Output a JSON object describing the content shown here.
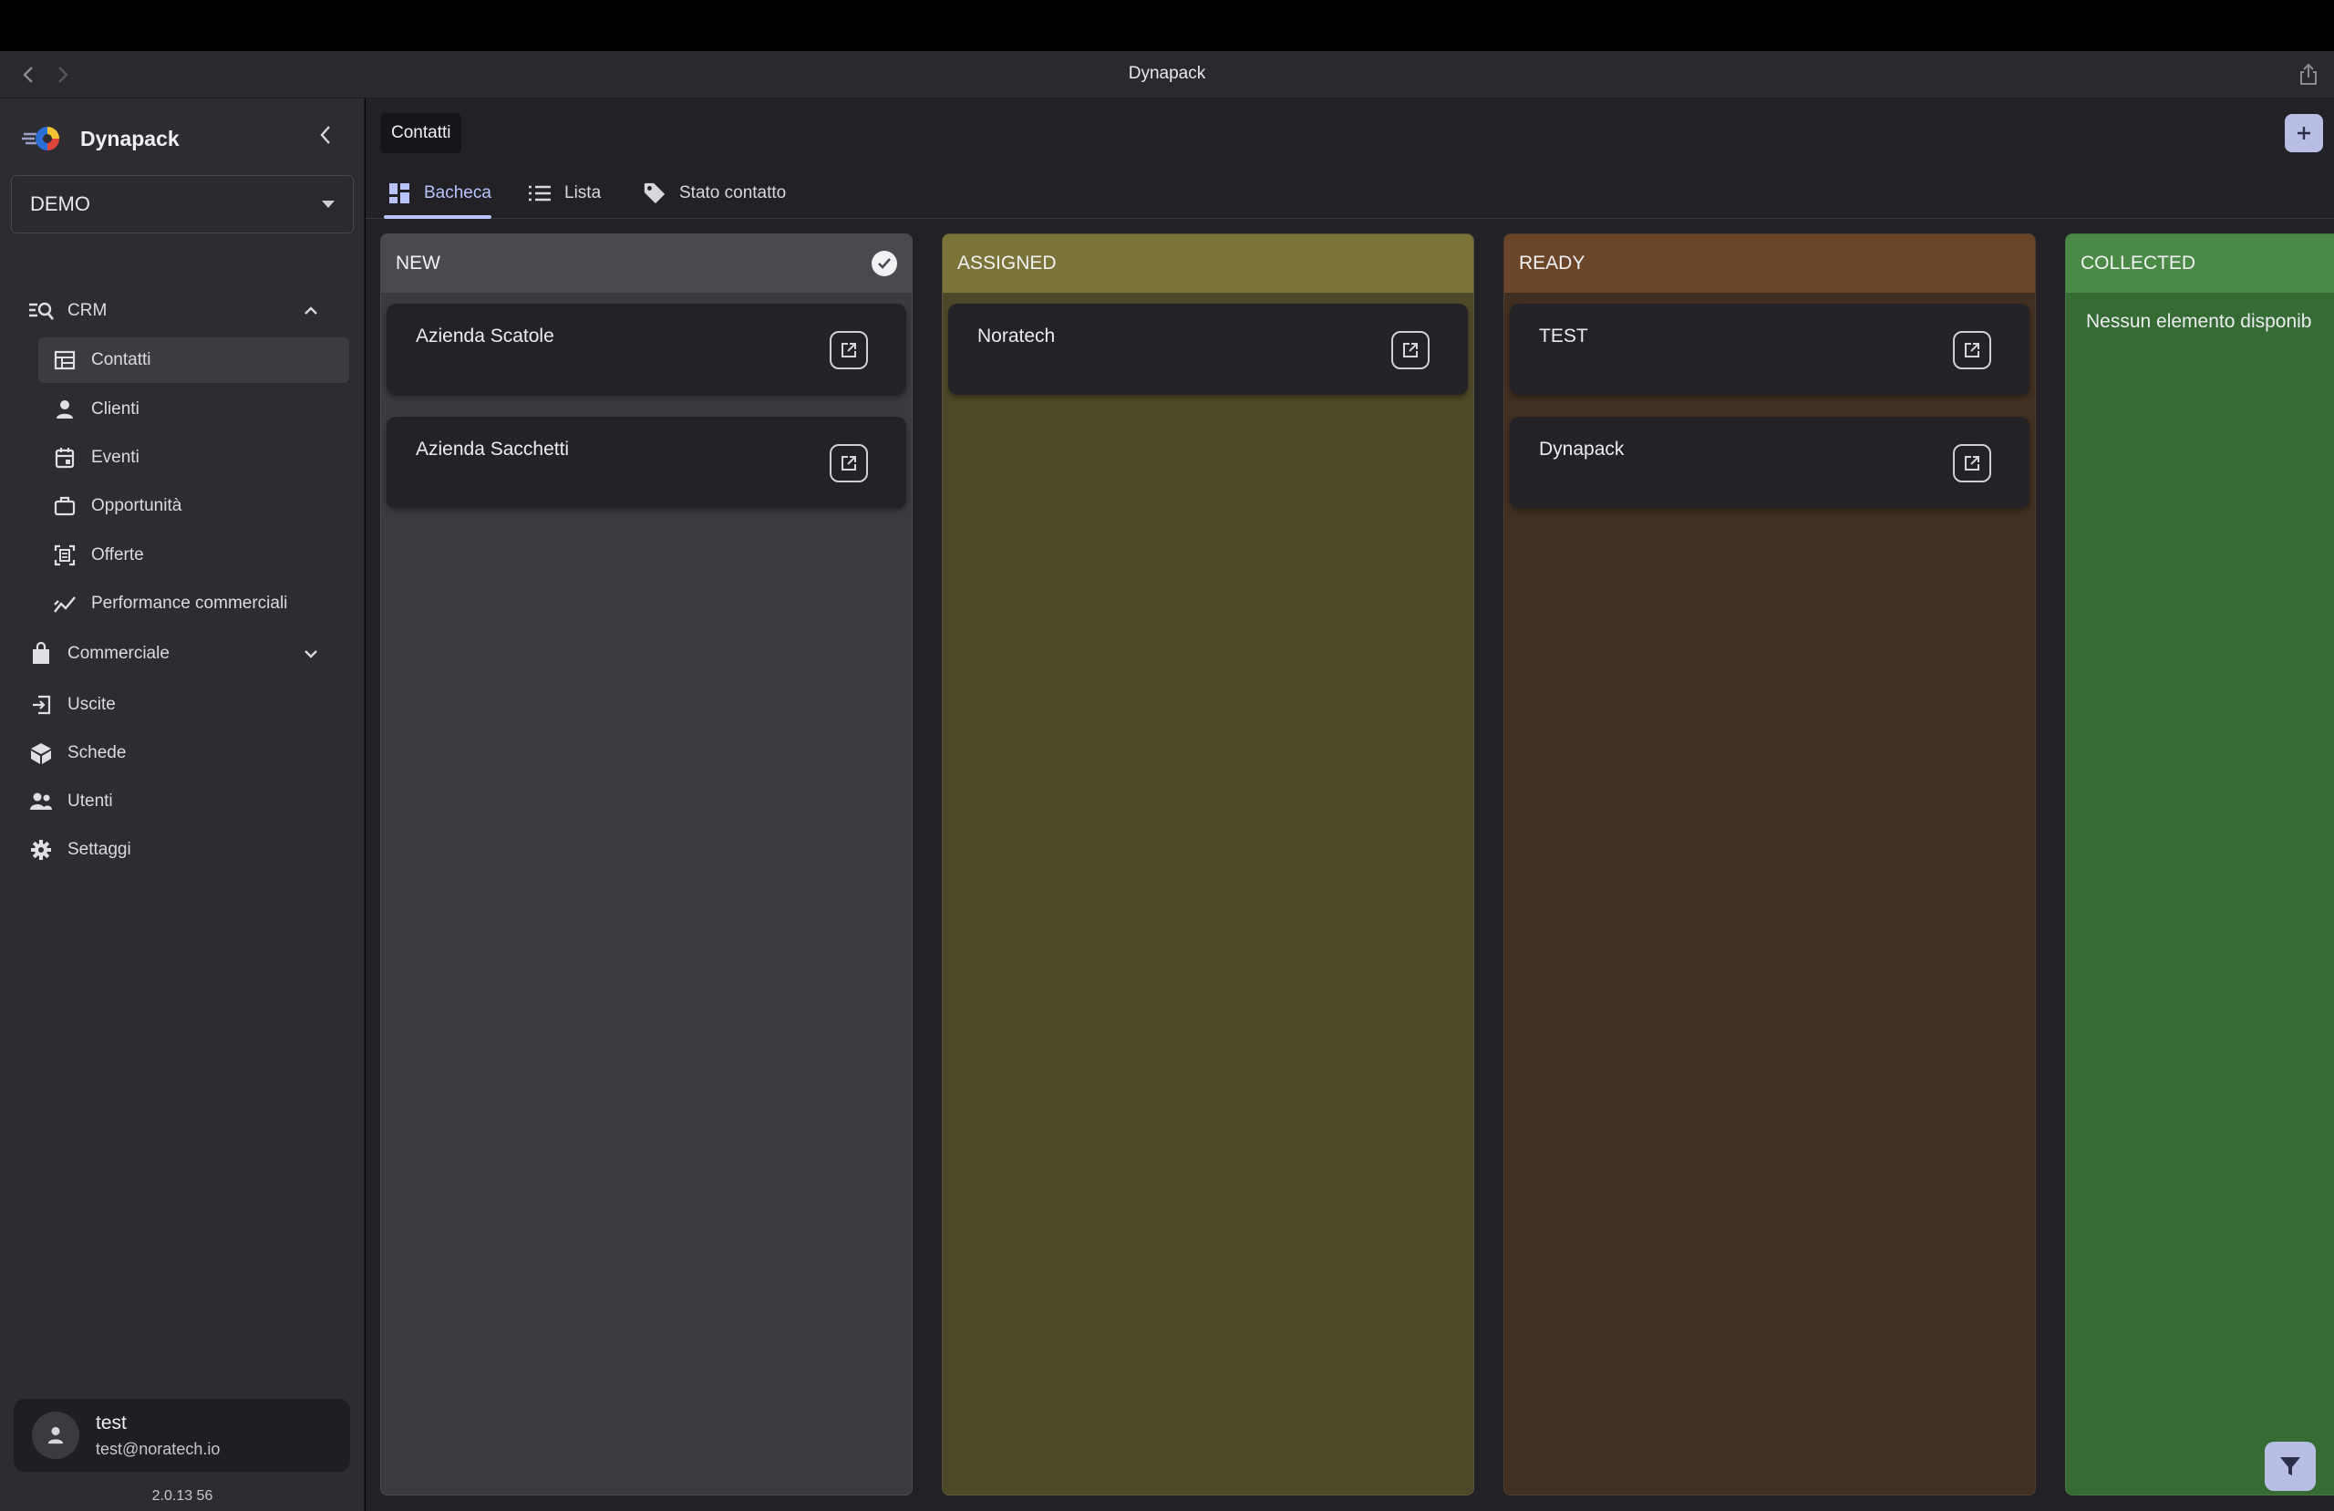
{
  "window": {
    "title": "Dynapack"
  },
  "sidebar": {
    "brand": "Dynapack",
    "environment": "DEMO",
    "menu": [
      {
        "label": "CRM",
        "icon": "crm-search-icon"
      },
      {
        "label": "Contatti",
        "icon": "table-icon"
      },
      {
        "label": "Clienti",
        "icon": "person-icon"
      },
      {
        "label": "Eventi",
        "icon": "calendar-icon"
      },
      {
        "label": "Opportunità",
        "icon": "briefcase-icon"
      },
      {
        "label": "Offerte",
        "icon": "offer-icon"
      },
      {
        "label": "Performance commerciali",
        "icon": "trend-icon"
      },
      {
        "label": "Commerciale",
        "icon": "shopping-bag-icon"
      },
      {
        "label": "Uscite",
        "icon": "exit-icon"
      },
      {
        "label": "Schede",
        "icon": "box-icon"
      },
      {
        "label": "Utenti",
        "icon": "users-icon"
      },
      {
        "label": "Settaggi",
        "icon": "gear-icon"
      }
    ],
    "user": {
      "name": "test",
      "email": "test@noratech.io"
    },
    "version": "2.0.13 56"
  },
  "main": {
    "page_title": "Contatti",
    "tabs": [
      {
        "label": "Bacheca",
        "icon": "grid-icon"
      },
      {
        "label": "Lista",
        "icon": "list-icon"
      },
      {
        "label": "Stato contatto",
        "icon": "tag-icon"
      }
    ],
    "columns": [
      {
        "title": "NEW",
        "color": "#3b3b3f",
        "head_color": "#4a4a4e",
        "cards": [
          "Azienda Scatole",
          "Azienda Sacchetti"
        ]
      },
      {
        "title": "ASSIGNED",
        "color": "#4d4928",
        "head_color": "#7a7439",
        "cards": [
          "Noratech"
        ]
      },
      {
        "title": "READY",
        "color": "#412f22",
        "head_color": "#6b4527",
        "cards": [
          "TEST",
          "Dynapack"
        ]
      },
      {
        "title": "COLLECTED",
        "color": "#366b34",
        "head_color": "#4b8a46",
        "cards": [],
        "empty": "Nessun elemento disponib"
      }
    ]
  }
}
